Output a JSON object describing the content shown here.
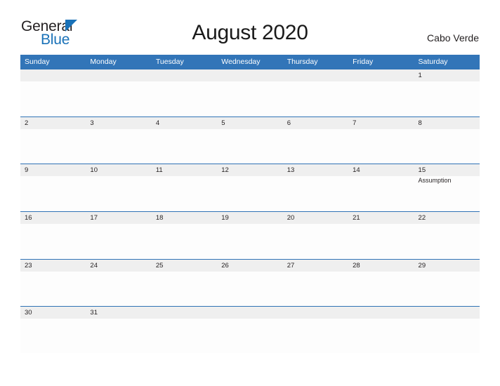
{
  "brand": {
    "word1": "General",
    "word2": "Blue",
    "triangle_icon": "triangle-flag-icon",
    "color_dark": "#231f20",
    "color_blue": "#1a72b8"
  },
  "header": {
    "title": "August 2020",
    "locale": "Cabo Verde"
  },
  "theme": {
    "header_blue": "#3275b8",
    "rule_blue": "#2f72b5",
    "daynum_band": "#efefef",
    "cell_bg": "#fdfdfd",
    "text": "#231f20"
  },
  "calendar": {
    "weekdays": [
      "Sunday",
      "Monday",
      "Tuesday",
      "Wednesday",
      "Thursday",
      "Friday",
      "Saturday"
    ],
    "weeks": [
      {
        "days": [
          {
            "num": "",
            "event": ""
          },
          {
            "num": "",
            "event": ""
          },
          {
            "num": "",
            "event": ""
          },
          {
            "num": "",
            "event": ""
          },
          {
            "num": "",
            "event": ""
          },
          {
            "num": "",
            "event": ""
          },
          {
            "num": "1",
            "event": ""
          }
        ]
      },
      {
        "days": [
          {
            "num": "2",
            "event": ""
          },
          {
            "num": "3",
            "event": ""
          },
          {
            "num": "4",
            "event": ""
          },
          {
            "num": "5",
            "event": ""
          },
          {
            "num": "6",
            "event": ""
          },
          {
            "num": "7",
            "event": ""
          },
          {
            "num": "8",
            "event": ""
          }
        ]
      },
      {
        "days": [
          {
            "num": "9",
            "event": ""
          },
          {
            "num": "10",
            "event": ""
          },
          {
            "num": "11",
            "event": ""
          },
          {
            "num": "12",
            "event": ""
          },
          {
            "num": "13",
            "event": ""
          },
          {
            "num": "14",
            "event": ""
          },
          {
            "num": "15",
            "event": "Assumption"
          }
        ]
      },
      {
        "days": [
          {
            "num": "16",
            "event": ""
          },
          {
            "num": "17",
            "event": ""
          },
          {
            "num": "18",
            "event": ""
          },
          {
            "num": "19",
            "event": ""
          },
          {
            "num": "20",
            "event": ""
          },
          {
            "num": "21",
            "event": ""
          },
          {
            "num": "22",
            "event": ""
          }
        ]
      },
      {
        "days": [
          {
            "num": "23",
            "event": ""
          },
          {
            "num": "24",
            "event": ""
          },
          {
            "num": "25",
            "event": ""
          },
          {
            "num": "26",
            "event": ""
          },
          {
            "num": "27",
            "event": ""
          },
          {
            "num": "28",
            "event": ""
          },
          {
            "num": "29",
            "event": ""
          }
        ]
      },
      {
        "days": [
          {
            "num": "30",
            "event": ""
          },
          {
            "num": "31",
            "event": ""
          },
          {
            "num": "",
            "event": ""
          },
          {
            "num": "",
            "event": ""
          },
          {
            "num": "",
            "event": ""
          },
          {
            "num": "",
            "event": ""
          },
          {
            "num": "",
            "event": ""
          }
        ]
      }
    ]
  }
}
